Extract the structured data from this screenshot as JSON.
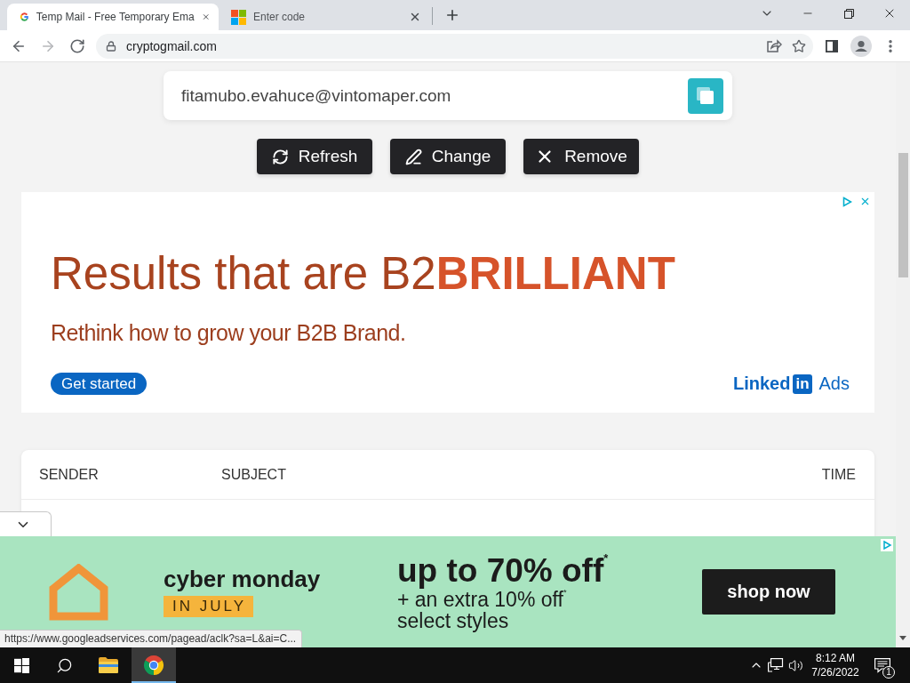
{
  "browser": {
    "tabs": [
      {
        "kind": "google",
        "title": "Temp Mail - Free Temporary Ema",
        "selected": true
      },
      {
        "kind": "microsoft",
        "title": "Enter code",
        "selected": false
      }
    ],
    "nav": [
      {
        "kind": "back",
        "disabled": false
      },
      {
        "kind": "forward",
        "disabled": true
      },
      {
        "kind": "reload",
        "disabled": false
      }
    ],
    "address": "cryptogmail.com"
  },
  "mailbox": {
    "email": "fitamubo.evahuce@vintomaper.com",
    "actions": [
      {
        "kind": "refresh",
        "label": "Refresh"
      },
      {
        "kind": "change",
        "label": "Change"
      },
      {
        "kind": "remove",
        "label": "Remove"
      }
    ]
  },
  "top_ad": {
    "headline": "Results that are B2**BRILLIANT**",
    "subline": "Rethink how to grow your B2B Brand.",
    "cta": "Get started",
    "brand": "Linked",
    "brand_badge": "in",
    "brand_suffix": "Ads"
  },
  "inbox": {
    "columns": [
      "SENDER",
      "SUBJECT",
      "TIME"
    ]
  },
  "bottom_ad": {
    "title": "cyber monday",
    "tag": "IN JULY",
    "offer": "up to 70% off$^{*}$",
    "extra": "+ an extra 10% off$^{*}$",
    "extra_note": "select styles",
    "cta": "shop now"
  },
  "status_url": "https://www.googleadservices.com/pagead/aclk?sa=L&ai=C...",
  "taskbar": {
    "apps": [
      {
        "kind": "start",
        "selected": false
      },
      {
        "kind": "search",
        "selected": false
      },
      {
        "kind": "explorer",
        "selected": false
      },
      {
        "kind": "chrome",
        "selected": true
      }
    ],
    "time": "8:12 AM",
    "date": "7/26/2022",
    "notifications": "1"
  }
}
